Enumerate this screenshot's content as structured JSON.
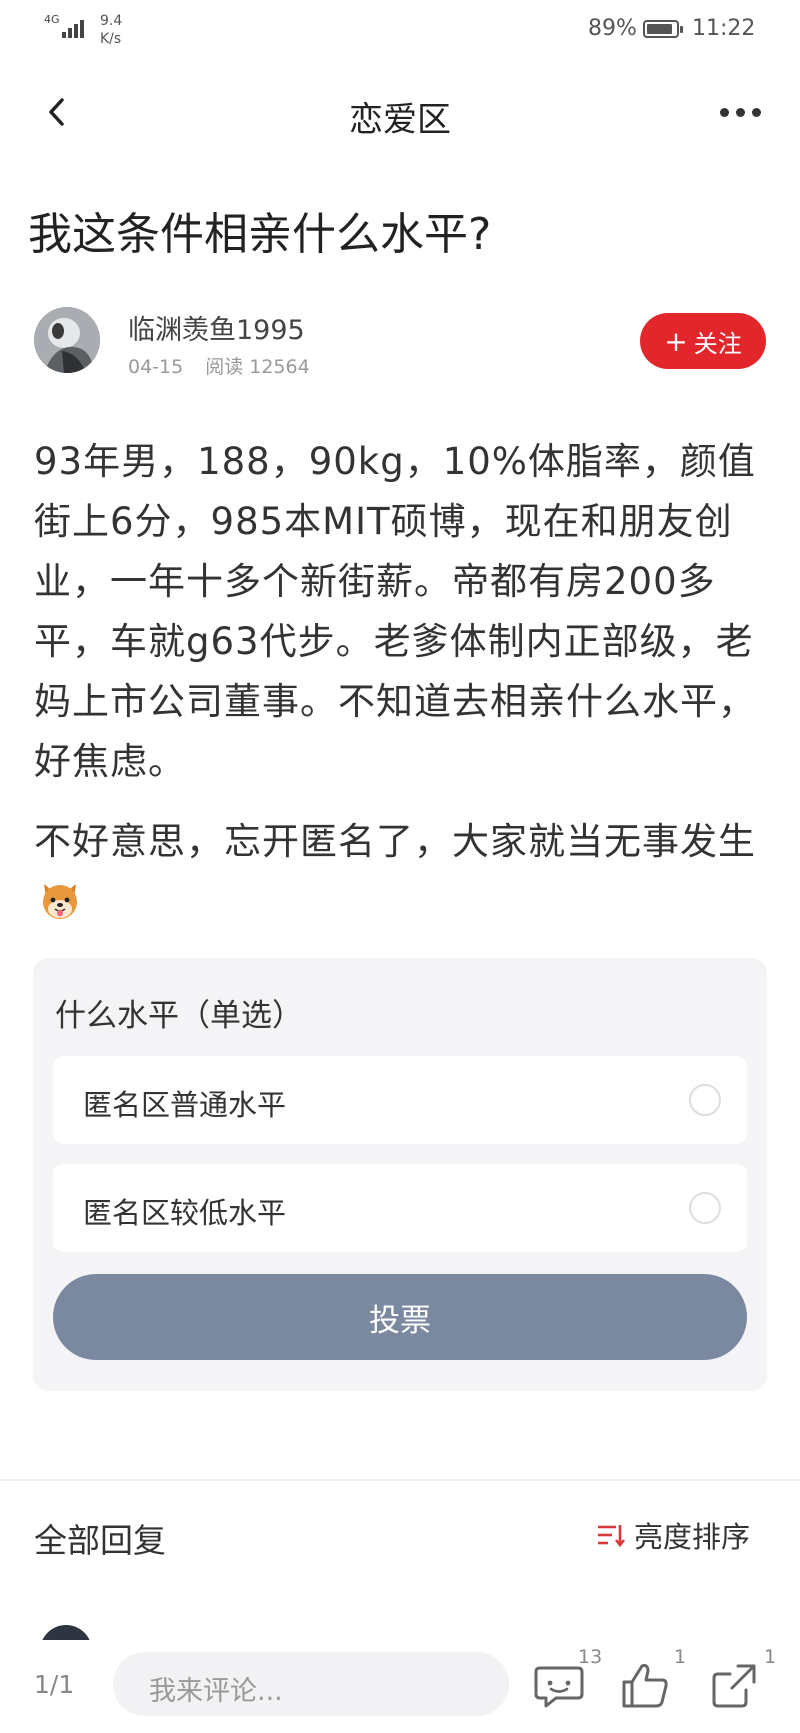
{
  "status_bar": {
    "network": "4G",
    "speed_value": "9.4",
    "speed_unit": "K/s",
    "battery": "89%",
    "battery_level": 0.89,
    "time": "11:22"
  },
  "nav": {
    "title": "恋爱区",
    "back_icon": "chevron-left-icon",
    "more_icon": "more-dots-icon"
  },
  "post": {
    "title": "我这条件相亲什么水平?",
    "author": "临渊羡鱼1995",
    "date": "04-15",
    "reads": "阅读 12564",
    "follow_label": "关注",
    "follow_icon": "plus",
    "paragraphs": [
      "93年男，188，90kg，10%体脂率，颜值街上6分，985本MIT硕博，现在和朋友创业，一年十多个新街薪。帝都有房200多平，车就g63代步。老爹体制内正部级，老妈上市公司董事。不知道去相亲什么水平，好焦虑。",
      "不好意思，忘开匿名了，大家就当无事发生"
    ],
    "emoji": "shiba-dog-emoji"
  },
  "poll": {
    "title": "什么水平（单选）",
    "options": [
      {
        "label": "匿名区普通水平",
        "selected": false
      },
      {
        "label": "匿名区较低水平",
        "selected": false
      }
    ],
    "vote_label": "投票"
  },
  "replies": {
    "title": "全部回复",
    "sort_label": "亮度排序",
    "sort_icon": "sort-icon"
  },
  "bottom_bar": {
    "page": "1/1",
    "comment_placeholder": "我来评论...",
    "comment_count": "13",
    "like_count": "1",
    "share_count": "1"
  },
  "colors": {
    "accent_red": "#e3262b",
    "vote_button": "#7a88a0",
    "poll_bg": "#f4f4f6"
  }
}
